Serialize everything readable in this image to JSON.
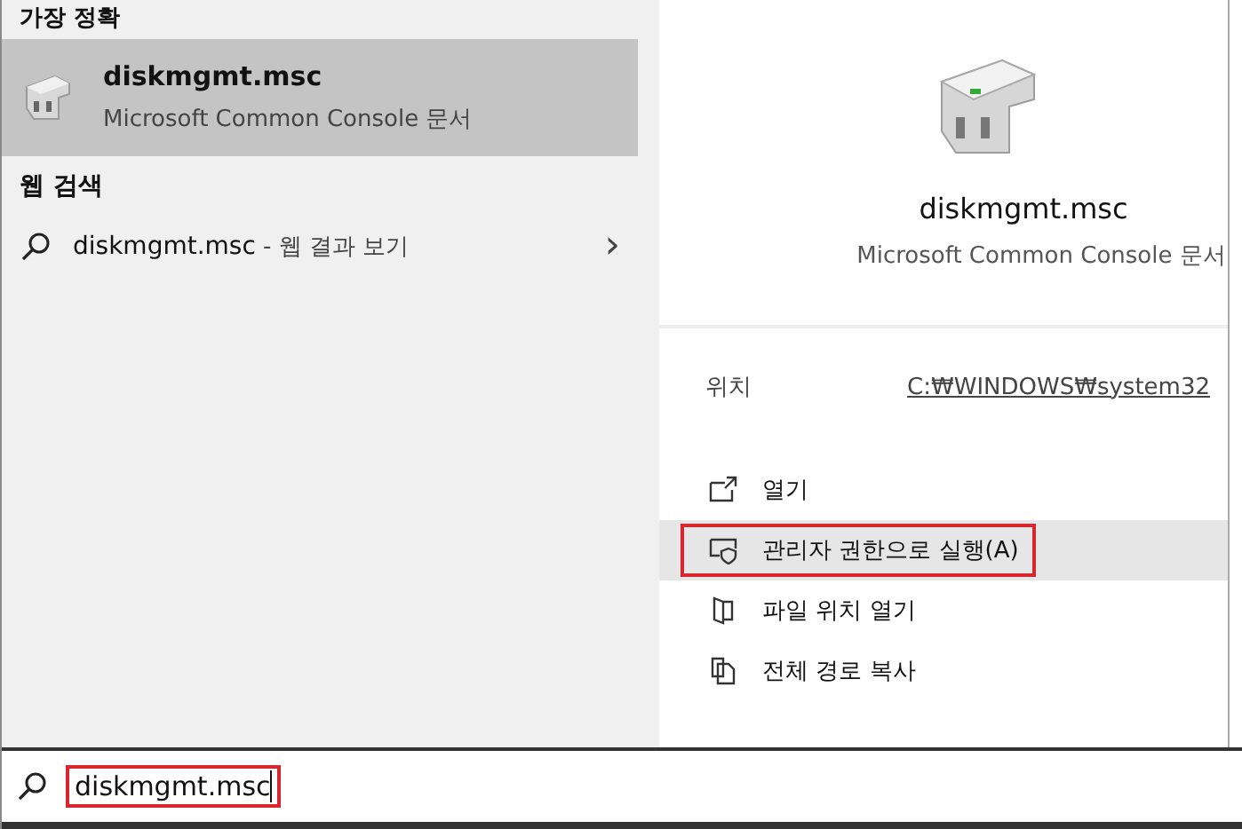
{
  "best_match": {
    "heading": "가장 정확",
    "item": {
      "name": "diskmgmt.msc",
      "type": "Microsoft Common Console 문서",
      "selected": true
    }
  },
  "web_search": {
    "heading": "웹 검색",
    "item": {
      "query": "diskmgmt.msc",
      "suffix": " - 웹 결과 보기",
      "arrow": "›"
    }
  },
  "details": {
    "name": "diskmgmt.msc",
    "type": "Microsoft Common Console 문서",
    "location_label": "위치",
    "location": "C:₩WINDOWS₩system32"
  },
  "actions": [
    {
      "kind": "open",
      "label": "열기",
      "hovered": false,
      "highlighted": false
    },
    {
      "kind": "admin",
      "label": "관리자 권한으로 실행(A)",
      "hovered": true,
      "highlighted": true
    },
    {
      "kind": "folder",
      "label": "파일 위치 열기",
      "hovered": false,
      "highlighted": false
    },
    {
      "kind": "copy",
      "label": "전체 경로 복사",
      "hovered": false,
      "highlighted": false
    }
  ],
  "search": {
    "value": "diskmgmt.msc",
    "highlighted": true
  }
}
